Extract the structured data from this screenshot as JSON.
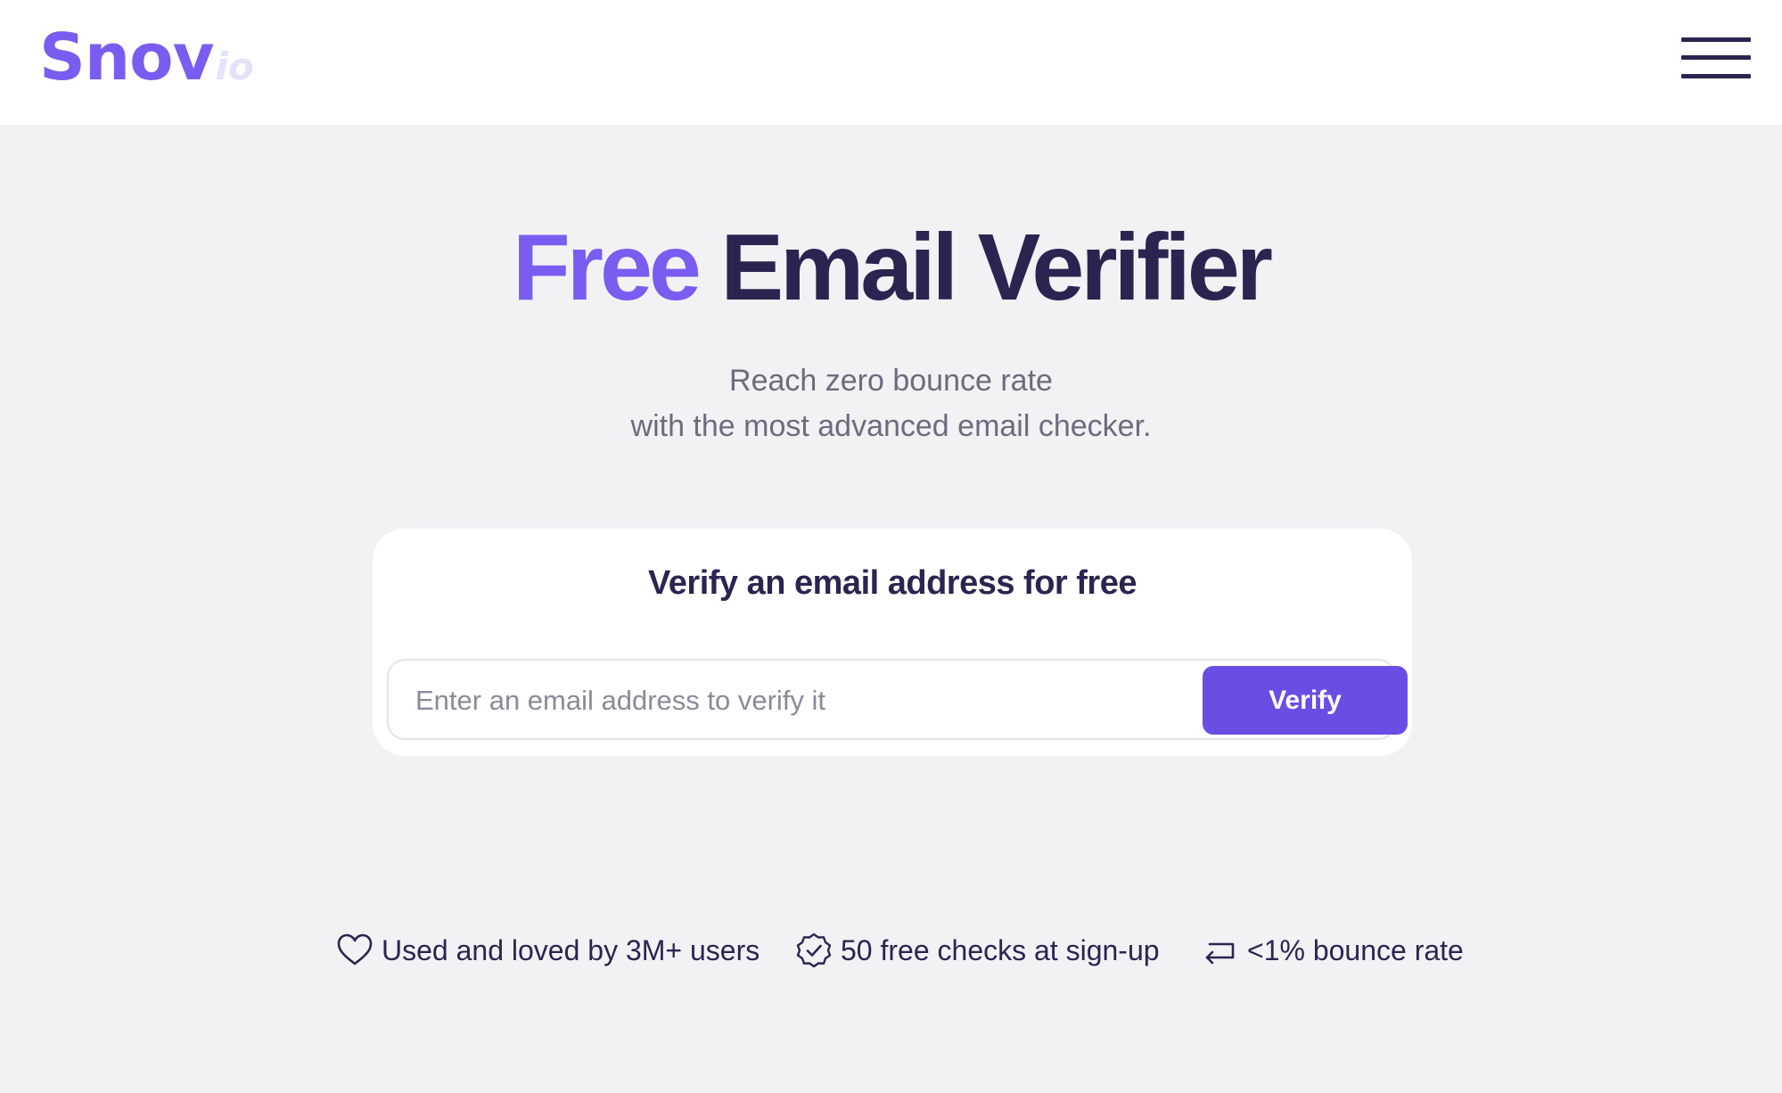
{
  "header": {
    "logo_main": "Snov",
    "logo_sub": "io",
    "menu_icon": "hamburger-menu-icon"
  },
  "hero": {
    "title_accent": "Free",
    "title_rest": "Email Verifier",
    "subtitle_line1": "Reach zero bounce rate",
    "subtitle_line2": "with the most advanced email checker."
  },
  "verifier": {
    "card_title": "Verify an email address for free",
    "input_value": "",
    "input_placeholder": "Enter an email address to verify it",
    "button_label": "Verify"
  },
  "features": [
    {
      "icon": "heart-icon",
      "label": "Used and loved by 3M+ users"
    },
    {
      "icon": "badge-check-icon",
      "label": "50 free checks at sign-up"
    },
    {
      "icon": "return-arrow-icon",
      "label": "<1% bounce rate"
    }
  ],
  "colors": {
    "brand": "#7a5cf0",
    "button": "#6a4ee4",
    "heading": "#2c2450",
    "subtitle": "#6d6b7d",
    "page_background": "#f2f2f5"
  }
}
